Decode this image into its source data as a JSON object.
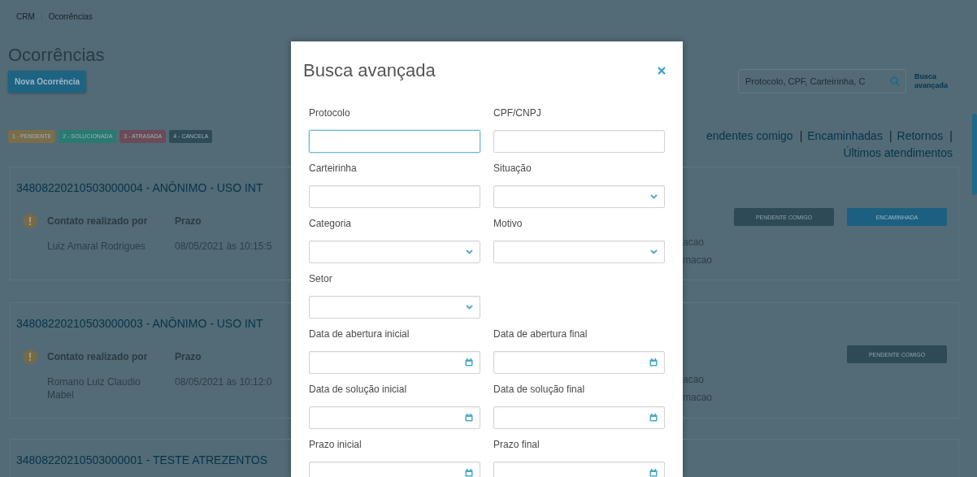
{
  "breadcrumb": [
    {
      "label": "CRM"
    },
    {
      "label": "Ocorrências"
    }
  ],
  "page_title": "Ocorrências",
  "new_button": "Nova Ocorrência",
  "status_tags": [
    {
      "label": "1 - PENDENTE",
      "color": "#7a6d4c"
    },
    {
      "label": "2 - SOLUCIONADA",
      "color": "#2a7a72"
    },
    {
      "label": "3 - ATRASADA",
      "color": "#6b4b57"
    },
    {
      "label": "4 - CANCELA",
      "color": "#2f4a58"
    }
  ],
  "search": {
    "placeholder": "Protocolo, CPF, Carteirinha, C"
  },
  "advanced_search_link": "Busca avançada",
  "filter_links": [
    {
      "kind": "link",
      "label": "endentes comigo"
    },
    {
      "kind": "separator",
      "label": "|"
    },
    {
      "kind": "link",
      "label": "Encaminhadas"
    },
    {
      "kind": "separator",
      "label": "|"
    },
    {
      "kind": "link",
      "label": "Retornos"
    },
    {
      "kind": "separator",
      "label": "|"
    },
    {
      "kind": "link",
      "label": "Últimos atendimentos"
    }
  ],
  "occurrences": [
    {
      "heading": "34808220210503000004 - ANÔNIMO - USO INT",
      "columns": [
        "Contato realizado por",
        "Prazo"
      ],
      "contact": "Luiz Amaral Rodrigues",
      "deadline": "08/05/2021 às 10:15:5",
      "right_lines": [
        "acao",
        "macao"
      ],
      "actions": [
        {
          "label": "PENDENTE COMIGO",
          "kind": "dark"
        },
        {
          "label": "ENCAMINHADA",
          "kind": "primary"
        }
      ]
    },
    {
      "heading": "34808220210503000003 - ANÔNIMO - USO INT",
      "columns": [
        "Contato realizado por",
        "Prazo"
      ],
      "contact": "Romano Luiz Claudio Mabel",
      "deadline": "08/05/2021 às 10:12:0",
      "right_lines": [
        "acao",
        "macao"
      ],
      "actions": [
        {
          "label": "PENDENTE COMIGO",
          "kind": "dark"
        }
      ]
    },
    {
      "heading": "34808220210503000001 - TESTE ATREZENTOS"
    }
  ],
  "modal": {
    "title": "Busca avançada",
    "rows": [
      [
        {
          "label": "Protocolo",
          "kind": "text",
          "focused": true
        },
        {
          "label": "CPF/CNPJ",
          "kind": "text",
          "focused": false
        }
      ],
      [
        {
          "label": "Carteirinha",
          "kind": "text",
          "focused": false
        },
        {
          "label": "Situação",
          "kind": "select",
          "focused": false
        }
      ],
      [
        {
          "label": "Categoria",
          "kind": "select",
          "focused": false
        },
        {
          "label": "Motivo",
          "kind": "select",
          "focused": false
        }
      ],
      [
        {
          "label": "Setor",
          "kind": "select",
          "focused": false
        }
      ],
      [
        {
          "label": "Data de abertura inicial",
          "kind": "date",
          "focused": false
        },
        {
          "label": "Data de abertura final",
          "kind": "date",
          "focused": false
        }
      ],
      [
        {
          "label": "Data de solução inicial",
          "kind": "date",
          "focused": false
        },
        {
          "label": "Data de solução final",
          "kind": "date",
          "focused": false
        }
      ],
      [
        {
          "label": "Prazo inicial",
          "kind": "date",
          "focused": false
        },
        {
          "label": "Prazo final",
          "kind": "date",
          "focused": false
        }
      ]
    ]
  }
}
